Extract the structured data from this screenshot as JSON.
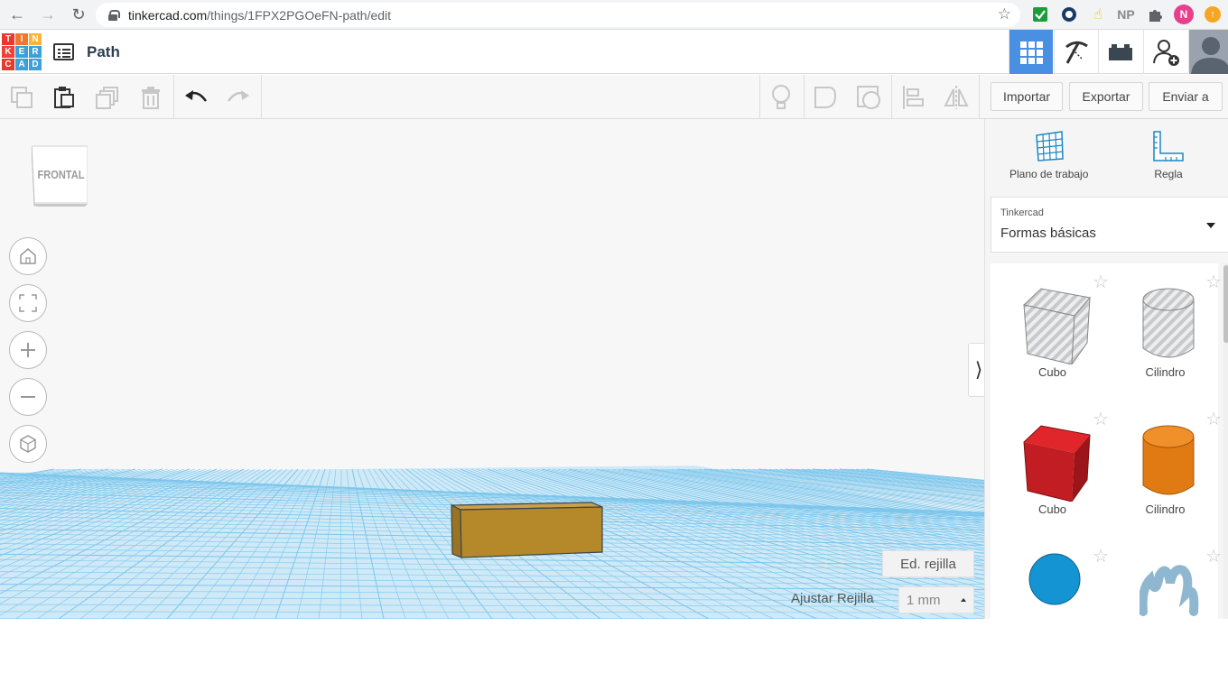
{
  "browser": {
    "url_host": "tinkercad.com",
    "url_path": "/things/1FPX2PGOeFN-path/edit",
    "extensions": [
      "check-extension-icon",
      "circle-extension-icon",
      "hand-extension-icon",
      "NP",
      "puzzle-extension-icon",
      "N",
      "update-icon"
    ]
  },
  "header": {
    "logo_letters": [
      "T",
      "I",
      "N",
      "K",
      "E",
      "R",
      "C",
      "A",
      "D"
    ],
    "logo_colors": [
      "#e8392d",
      "#f4762b",
      "#fbb433",
      "#ef4136",
      "#3aa2db",
      "#3aa2db",
      "#e8392d",
      "#3aa2db",
      "#3aa2db"
    ],
    "design_title": "Path",
    "buttons": [
      "3d-view-icon",
      "pickaxe-icon",
      "bricks-icon",
      "add-user-icon",
      "avatar"
    ]
  },
  "toolbar": {
    "edit_tools": [
      "copy-icon",
      "paste-icon",
      "duplicate-icon",
      "delete-icon",
      "undo-icon",
      "redo-icon"
    ],
    "shape_tools": [
      "lightbulb-icon",
      "solid-icon",
      "hole-icon",
      "align-icon",
      "mirror-icon"
    ],
    "import_label": "Importar",
    "export_label": "Exportar",
    "send_label": "Enviar a"
  },
  "workspace": {
    "viewcube_label": "FRONTAL",
    "controls": [
      "home-icon",
      "fit-icon",
      "zoom-in-icon",
      "zoom-out-icon",
      "perspective-icon"
    ],
    "edit_grid_label": "Ed. rejilla",
    "snap_label": "Ajustar Rejilla",
    "snap_value": "1 mm",
    "grid_color": "#7cc6ec",
    "box_color": "#b5892a"
  },
  "panel": {
    "workplane_label": "Plano de trabajo",
    "ruler_label": "Regla",
    "library_caption": "Tinkercad",
    "library_value": "Formas básicas",
    "shapes": [
      {
        "name": "Cubo",
        "kind": "cube-hole"
      },
      {
        "name": "Cilindro",
        "kind": "cylinder-hole"
      },
      {
        "name": "Cubo",
        "kind": "cube-red"
      },
      {
        "name": "Cilindro",
        "kind": "cylinder-orange"
      },
      {
        "name": "",
        "kind": "sphere-blue"
      },
      {
        "name": "",
        "kind": "scribble"
      }
    ]
  }
}
